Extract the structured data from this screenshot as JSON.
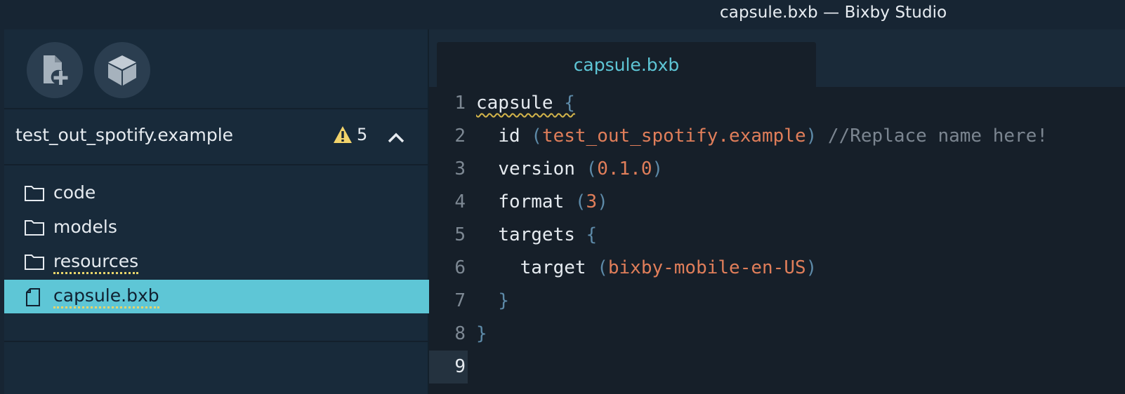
{
  "window": {
    "title": "capsule.bxb — Bixby Studio"
  },
  "toolbar": {
    "new_file_icon": "new-file-icon",
    "cube_icon": "cube-icon"
  },
  "project": {
    "name": "test_out_spotify.example",
    "warning_count": "5",
    "warning_icon": "warning-icon",
    "collapse_icon": "chevron-up-icon"
  },
  "tree": {
    "items": [
      {
        "label": "code",
        "icon": "folder-icon"
      },
      {
        "label": "models",
        "icon": "folder-icon"
      },
      {
        "label": "resources",
        "icon": "folder-icon"
      },
      {
        "label": "capsule.bxb",
        "icon": "file-icon",
        "selected": true
      }
    ]
  },
  "editor": {
    "tab": {
      "label": "capsule.bxb"
    },
    "lines": [
      {
        "n": "1",
        "indent": "",
        "kw": "capsule",
        "open": " {",
        "val": "",
        "close": "",
        "cmt": ""
      },
      {
        "n": "2",
        "indent": "  ",
        "kw": "id",
        "open": " (",
        "val": "test_out_spotify.example",
        "close": ")",
        "cmt": " //Replace name here!"
      },
      {
        "n": "3",
        "indent": "  ",
        "kw": "version",
        "open": " (",
        "val": "0.1.0",
        "close": ")",
        "cmt": ""
      },
      {
        "n": "4",
        "indent": "  ",
        "kw": "format",
        "open": " (",
        "val": "3",
        "close": ")",
        "cmt": ""
      },
      {
        "n": "5",
        "indent": "  ",
        "kw": "targets",
        "open": " {",
        "val": "",
        "close": "",
        "cmt": ""
      },
      {
        "n": "6",
        "indent": "    ",
        "kw": "target",
        "open": " (",
        "val": "bixby-mobile-en-US",
        "close": ")",
        "cmt": ""
      },
      {
        "n": "7",
        "indent": "  ",
        "kw": "",
        "open": "}",
        "val": "",
        "close": "",
        "cmt": ""
      },
      {
        "n": "8",
        "indent": "",
        "kw": "",
        "open": "}",
        "val": "",
        "close": "",
        "cmt": ""
      },
      {
        "n": "9",
        "indent": "",
        "kw": "",
        "open": "",
        "val": "",
        "close": "",
        "cmt": ""
      }
    ]
  },
  "colors": {
    "accent": "#5ec6d6",
    "value": "#e07e5a",
    "warning": "#e8d46a"
  }
}
